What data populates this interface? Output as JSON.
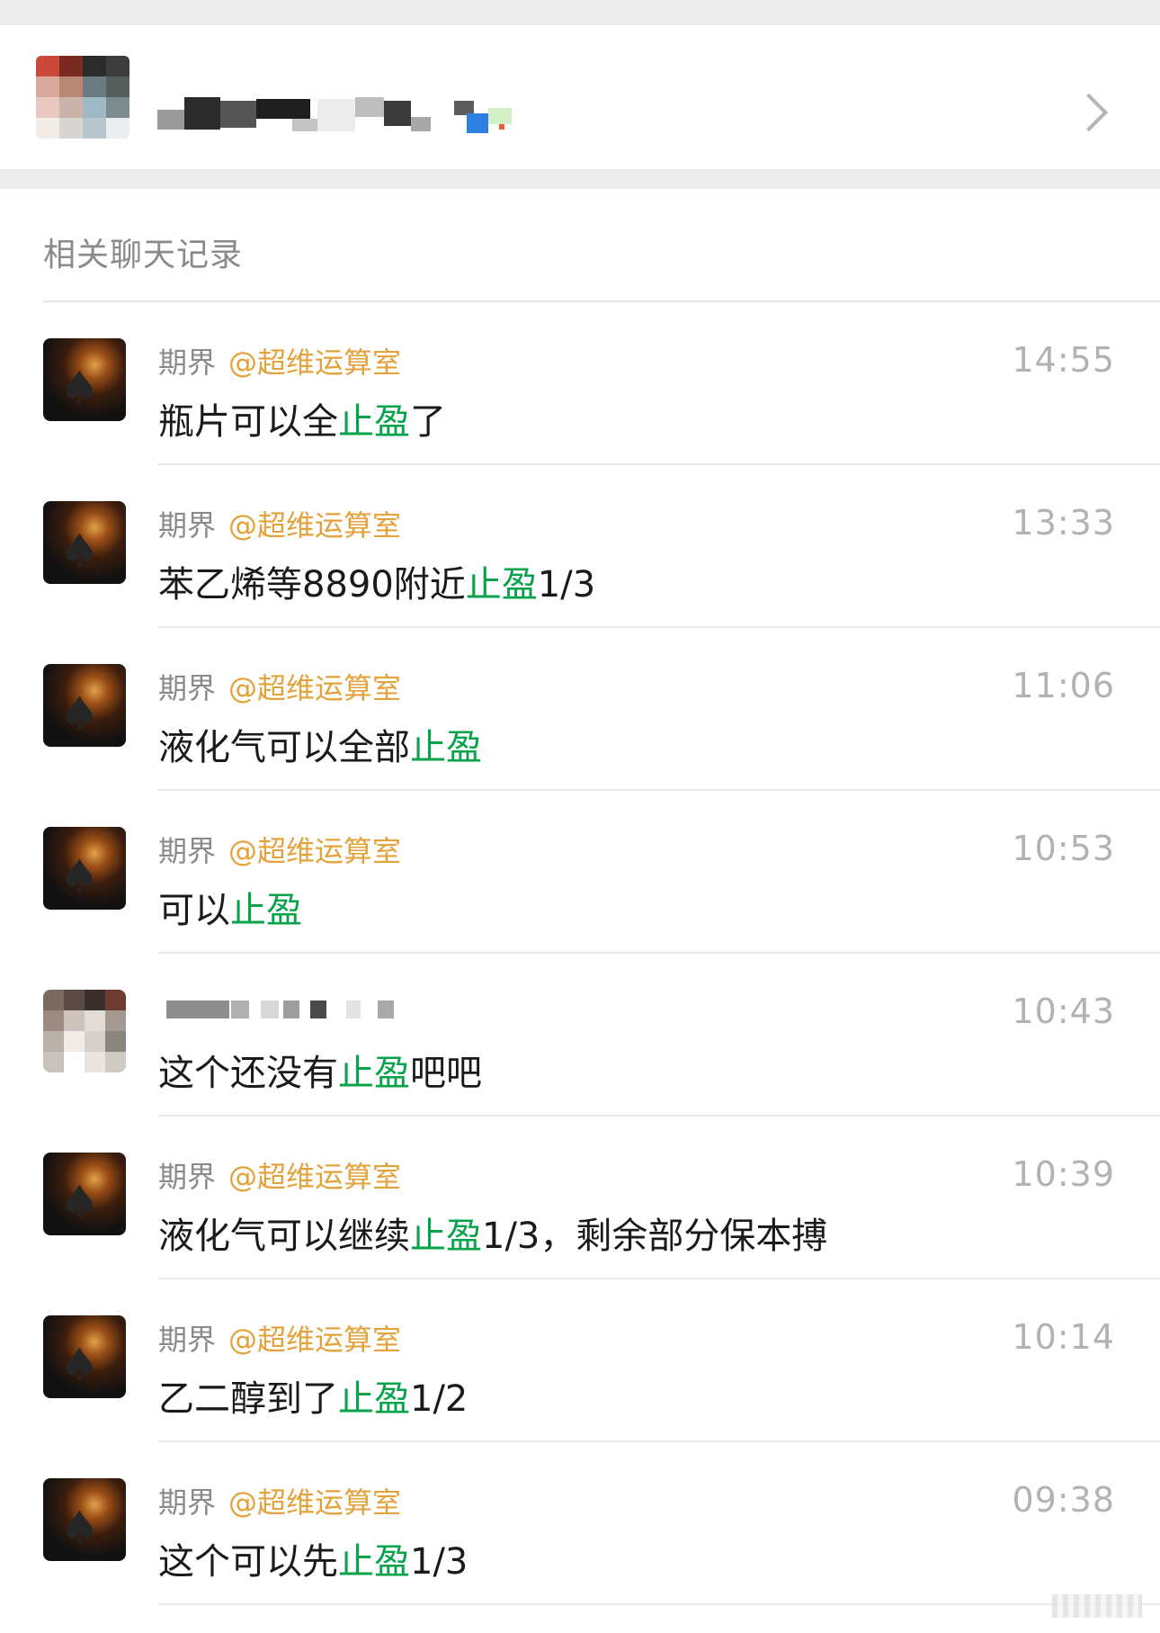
{
  "section_title": "相关聊天记录",
  "colors": {
    "mention": "#e3a23b",
    "highlight": "#07a34a",
    "timestamp": "#b2b2b2",
    "sender": "#8a8a8a",
    "message": "#1a1a1a"
  },
  "group_header": {
    "avatar_icon": "group-avatar-blurred",
    "chevron_icon": "chevron-right-icon"
  },
  "results": [
    {
      "sender": "期界",
      "mention": "@超维运算室",
      "time": "14:55",
      "before": "瓶片可以全",
      "keyword": "止盈",
      "after": "了"
    },
    {
      "sender": "期界",
      "mention": "@超维运算室",
      "time": "13:33",
      "before": "苯乙烯等8890附近",
      "keyword": "止盈",
      "after": "1/3"
    },
    {
      "sender": "期界",
      "mention": "@超维运算室",
      "time": "11:06",
      "before": "液化气可以全部",
      "keyword": "止盈",
      "after": ""
    },
    {
      "sender": "期界",
      "mention": "@超维运算室",
      "time": "10:53",
      "before": "可以",
      "keyword": "止盈",
      "after": ""
    },
    {
      "sender": "",
      "mention": "",
      "time": "10:43",
      "before": "这个还没有",
      "keyword": "止盈",
      "after": "吧吧"
    },
    {
      "sender": "期界",
      "mention": "@超维运算室",
      "time": "10:39",
      "before": "液化气可以继续",
      "keyword": "止盈",
      "after": "1/3，剩余部分保本搏"
    },
    {
      "sender": "期界",
      "mention": "@超维运算室",
      "time": "10:14",
      "before": "乙二醇到了",
      "keyword": "止盈",
      "after": "1/2"
    },
    {
      "sender": "期界",
      "mention": "@超维运算室",
      "time": "09:38",
      "before": "这个可以先",
      "keyword": "止盈",
      "after": "1/3"
    }
  ]
}
